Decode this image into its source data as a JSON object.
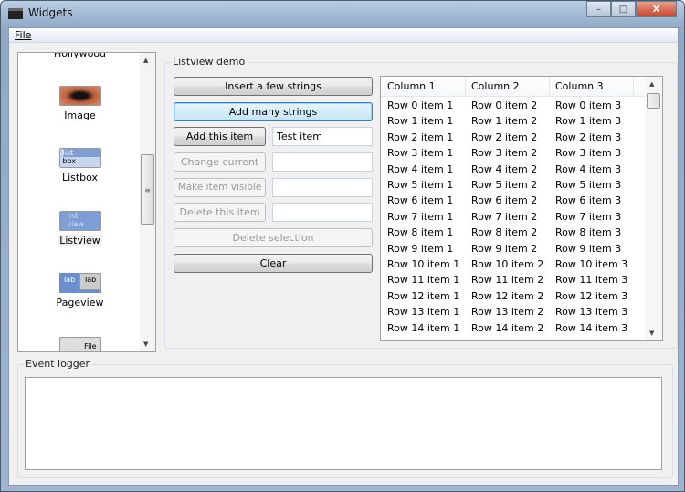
{
  "window": {
    "title": "Widgets",
    "minimize": "–",
    "maximize": "□",
    "close": "X"
  },
  "menu": {
    "file": "File"
  },
  "sidebar": {
    "items": [
      {
        "label": "Hollywood",
        "icon": "hollywood-icon"
      },
      {
        "label": "Image",
        "icon": "image-icon"
      },
      {
        "label": "Listbox",
        "icon": "listbox-icon"
      },
      {
        "label": "Listview",
        "icon": "listview-icon"
      },
      {
        "label": "Pageview",
        "icon": "pageview-icon"
      },
      {
        "label": "",
        "icon": "file-icon"
      }
    ],
    "listbox_icon_text": [
      "list",
      "box"
    ],
    "listview_icon_text": [
      "list",
      "view"
    ],
    "tab_labels": [
      "Tab",
      "Tab"
    ],
    "file_label": "File"
  },
  "demo": {
    "title": "Listview demo",
    "insert_few": "Insert a few strings",
    "add_many": "Add many strings",
    "add_item": "Add this item",
    "add_item_value": "Test item",
    "change_current": "Change current",
    "make_visible": "Make item visible",
    "delete_item": "Delete this item",
    "delete_selection": "Delete selection",
    "clear": "Clear"
  },
  "listview": {
    "columns": [
      "Column 1",
      "Column 2",
      "Column 3"
    ],
    "rows": [
      [
        "Row 0 item 1",
        "Row 0 item 2",
        "Row 0 item 3"
      ],
      [
        "Row 1 item 1",
        "Row 1 item 2",
        "Row 1 item 3"
      ],
      [
        "Row 2 item 1",
        "Row 2 item 2",
        "Row 2 item 3"
      ],
      [
        "Row 3 item 1",
        "Row 3 item 2",
        "Row 3 item 3"
      ],
      [
        "Row 4 item 1",
        "Row 4 item 2",
        "Row 4 item 3"
      ],
      [
        "Row 5 item 1",
        "Row 5 item 2",
        "Row 5 item 3"
      ],
      [
        "Row 6 item 1",
        "Row 6 item 2",
        "Row 6 item 3"
      ],
      [
        "Row 7 item 1",
        "Row 7 item 2",
        "Row 7 item 3"
      ],
      [
        "Row 8 item 1",
        "Row 8 item 2",
        "Row 8 item 3"
      ],
      [
        "Row 9 item 1",
        "Row 9 item 2",
        "Row 9 item 3"
      ],
      [
        "Row 10 item 1",
        "Row 10 item 2",
        "Row 10 item 3"
      ],
      [
        "Row 11 item 1",
        "Row 11 item 2",
        "Row 11 item 3"
      ],
      [
        "Row 12 item 1",
        "Row 12 item 2",
        "Row 12 item 3"
      ],
      [
        "Row 13 item 1",
        "Row 13 item 2",
        "Row 13 item 3"
      ],
      [
        "Row 14 item 1",
        "Row 14 item 2",
        "Row 14 item 3"
      ]
    ]
  },
  "logger": {
    "title": "Event logger"
  }
}
